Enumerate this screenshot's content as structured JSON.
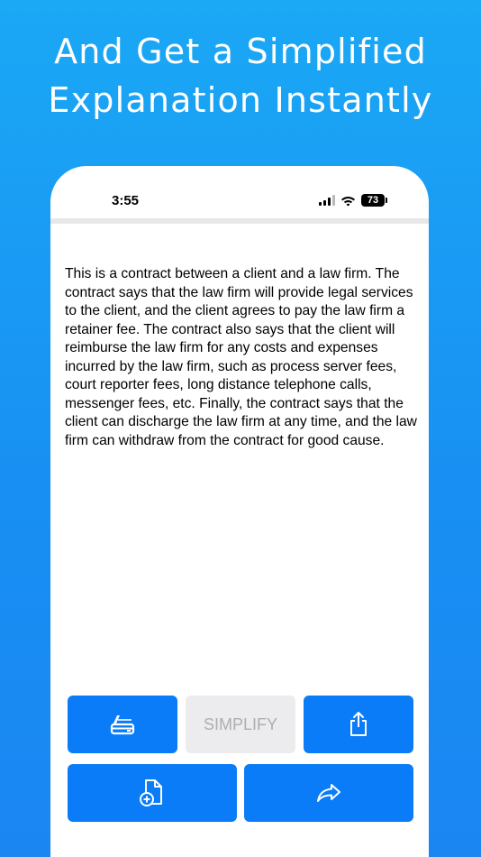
{
  "headline": {
    "line1": "And Get a Simplified",
    "line2": "Explanation Instantly"
  },
  "status_bar": {
    "time": "3:55",
    "battery_level": "73"
  },
  "content": {
    "explanation": "This is a contract between a client and a law firm. The contract says that the law firm will provide legal services to the client, and the client agrees to pay the law firm a retainer fee. The contract also says that the client will reimburse the law firm for any costs and expenses incurred by the law firm, such as process server fees, court reporter fees, long distance telephone calls, messenger fees, etc. Finally, the contract says that the client can discharge the law firm at any time, and the law firm can withdraw from the contract for good cause."
  },
  "toolbar": {
    "scan_icon": "scanner-icon",
    "simplify_label": "SIMPLIFY",
    "share_icon": "share-icon",
    "new_document_icon": "add-document-icon",
    "forward_icon": "forward-arrow-icon"
  },
  "colors": {
    "accent": "#0a7cf8",
    "background_top": "#1ba8f5",
    "disabled_bg": "#ececee",
    "disabled_text": "#aeaeb2"
  }
}
